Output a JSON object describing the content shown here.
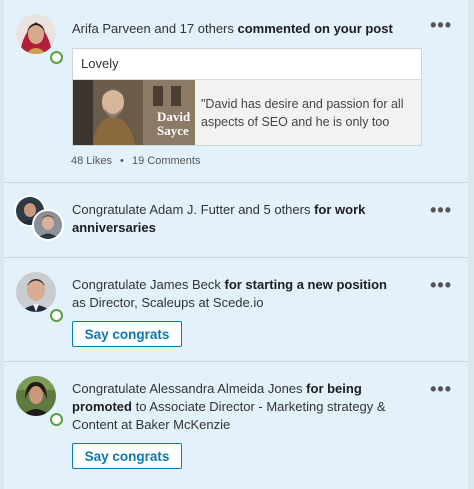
{
  "feed": {
    "items": [
      {
        "actor": "Arifa Parveen and 17 others",
        "action": "commented on your post",
        "comment": "Lovely",
        "preview_text": "\"David has desire and passion for all aspects of SEO and he is only too",
        "preview_image_caption": "David Sayce",
        "likes": "48 Likes",
        "separator": "•",
        "comments": "19 Comments",
        "more_label": "•••"
      },
      {
        "lead": "Congratulate Adam J. Futter and 5 others",
        "emphasis": "for work anniversaries",
        "more_label": "•••"
      },
      {
        "lead": "Congratulate James Beck",
        "emphasis": "for starting a new position",
        "tail": "as Director, Scaleups at Scede.io",
        "button": "Say congrats",
        "more_label": "•••"
      },
      {
        "lead": "Congratulate Alessandra Almeida Jones",
        "emphasis": "for being promoted",
        "tail": "to Associate Director - Marketing strategy & Content at Baker McKenzie",
        "button": "Say congrats",
        "more_label": "•••"
      }
    ]
  },
  "colors": {
    "card_bg": "#e3f1fa",
    "accent": "#0a7ab5",
    "presence": "#5aa33c"
  }
}
